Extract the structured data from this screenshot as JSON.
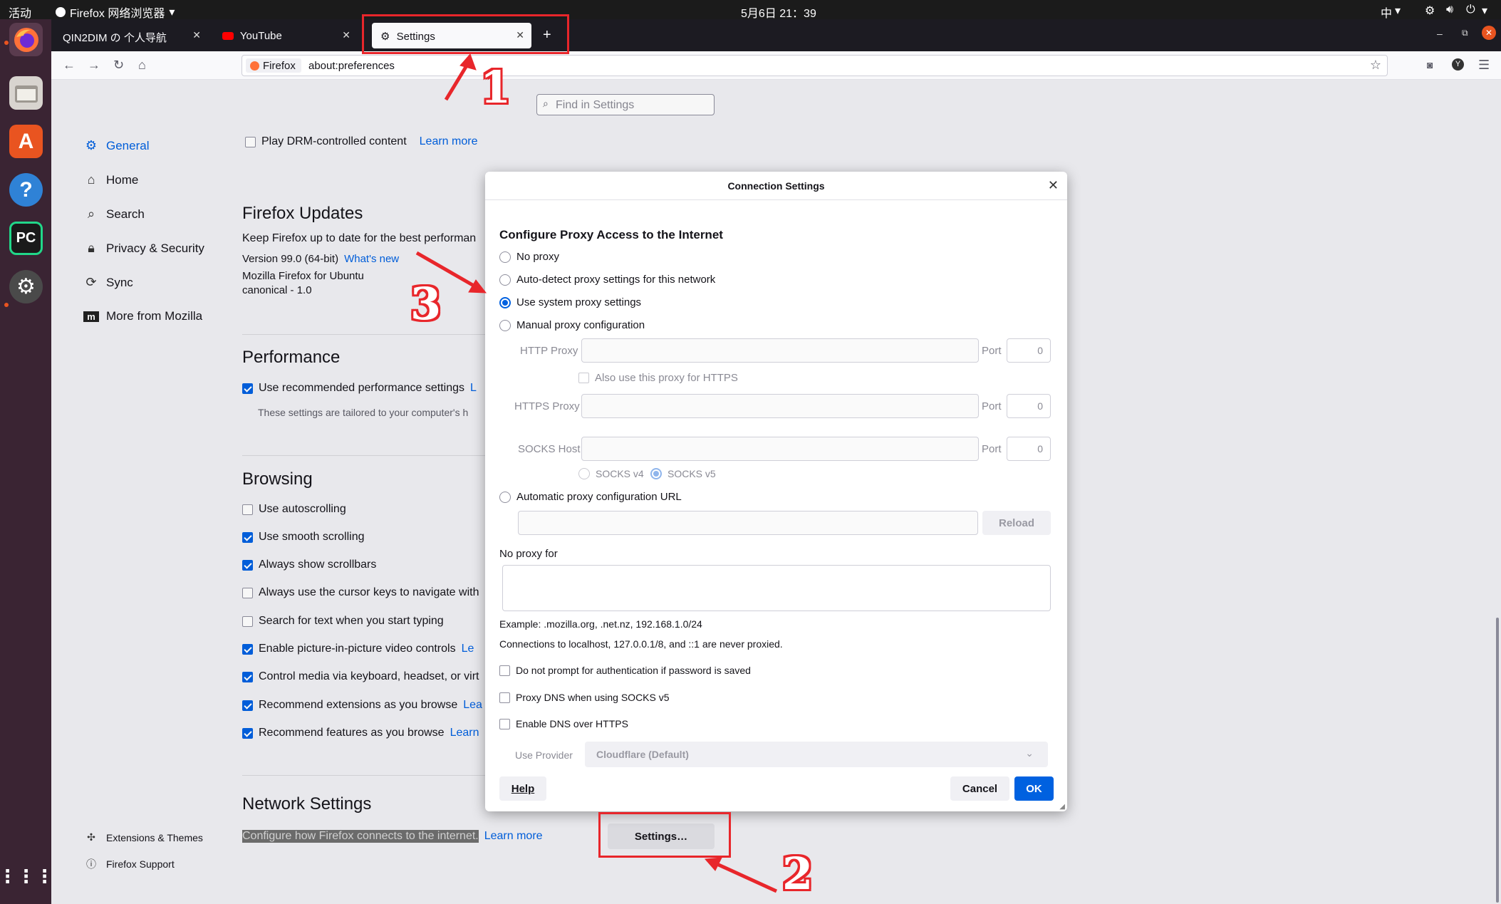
{
  "topbar": {
    "activities": "活动",
    "app_menu": "Firefox 网络浏览器",
    "clock": "5月6日  21：39",
    "ime": "中"
  },
  "tabs": [
    {
      "label": "QIN2DIM の 个人导航"
    },
    {
      "label": "YouTube"
    },
    {
      "label": "Settings"
    }
  ],
  "urlbar": {
    "identity": "Firefox",
    "url": "about:preferences"
  },
  "search": {
    "placeholder": "Find in Settings"
  },
  "sidebar": {
    "items": [
      {
        "label": "General"
      },
      {
        "label": "Home"
      },
      {
        "label": "Search"
      },
      {
        "label": "Privacy & Security"
      },
      {
        "label": "Sync"
      },
      {
        "label": "More from Mozilla"
      }
    ],
    "footer": [
      {
        "label": "Extensions & Themes"
      },
      {
        "label": "Firefox Support"
      }
    ]
  },
  "content": {
    "drm": {
      "label": "Play DRM-controlled content",
      "link": "Learn more"
    },
    "updates": {
      "title": "Firefox Updates",
      "desc": "Keep Firefox up to date for the best performan",
      "version": "Version 99.0 (64-bit)",
      "whats_new": "What's new",
      "distro": "Mozilla Firefox for Ubuntu",
      "canonical": "canonical - 1.0"
    },
    "performance": {
      "title": "Performance",
      "recommended": "Use recommended performance settings",
      "recommended_link": "L",
      "note": "These settings are tailored to your computer's h"
    },
    "browsing": {
      "title": "Browsing",
      "items": [
        {
          "label": "Use autoscrolling",
          "link": ""
        },
        {
          "label": "Use smooth scrolling",
          "link": ""
        },
        {
          "label": "Always show scrollbars",
          "link": ""
        },
        {
          "label": "Always use the cursor keys to navigate with",
          "link": ""
        },
        {
          "label": "Search for text when you start typing",
          "link": ""
        },
        {
          "label": "Enable picture-in-picture video controls",
          "link": "Le"
        },
        {
          "label": "Control media via keyboard, headset, or virt",
          "link": ""
        },
        {
          "label": "Recommend extensions as you browse",
          "link": "Lea"
        },
        {
          "label": "Recommend features as you browse",
          "link": "Learn"
        }
      ]
    },
    "network": {
      "title": "Network Settings",
      "desc": "Configure how Firefox connects to the internet.",
      "link": "Learn more",
      "button": "Settings…"
    }
  },
  "dialog": {
    "title": "Connection Settings",
    "heading": "Configure Proxy Access to the Internet",
    "options": [
      {
        "label": "No proxy"
      },
      {
        "label": "Auto-detect proxy settings for this network"
      },
      {
        "label": "Use system proxy settings"
      },
      {
        "label": "Manual proxy configuration"
      }
    ],
    "http_proxy": "HTTP Proxy",
    "also_https": "Also use this proxy for HTTPS",
    "https_proxy": "HTTPS Proxy",
    "socks_host": "SOCKS Host",
    "port": "Port",
    "port_value": "0",
    "socks_v4": "SOCKS v4",
    "socks_v5": "SOCKS v5",
    "auto_url": "Automatic proxy configuration URL",
    "reload": "Reload",
    "no_proxy_for": "No proxy for",
    "example": "Example: .mozilla.org, .net.nz, 192.168.1.0/24",
    "localhost_note": "Connections to localhost, 127.0.0.1/8, and ::1 are never proxied.",
    "no_prompt": "Do not prompt for authentication if password is saved",
    "proxy_dns": "Proxy DNS when using SOCKS v5",
    "doh": "Enable DNS over HTTPS",
    "use_provider": "Use Provider",
    "provider_value": "Cloudflare (Default)",
    "help": "Help",
    "cancel": "Cancel",
    "ok": "OK"
  },
  "annotations": {
    "one": "1",
    "two": "2",
    "three": "3"
  }
}
